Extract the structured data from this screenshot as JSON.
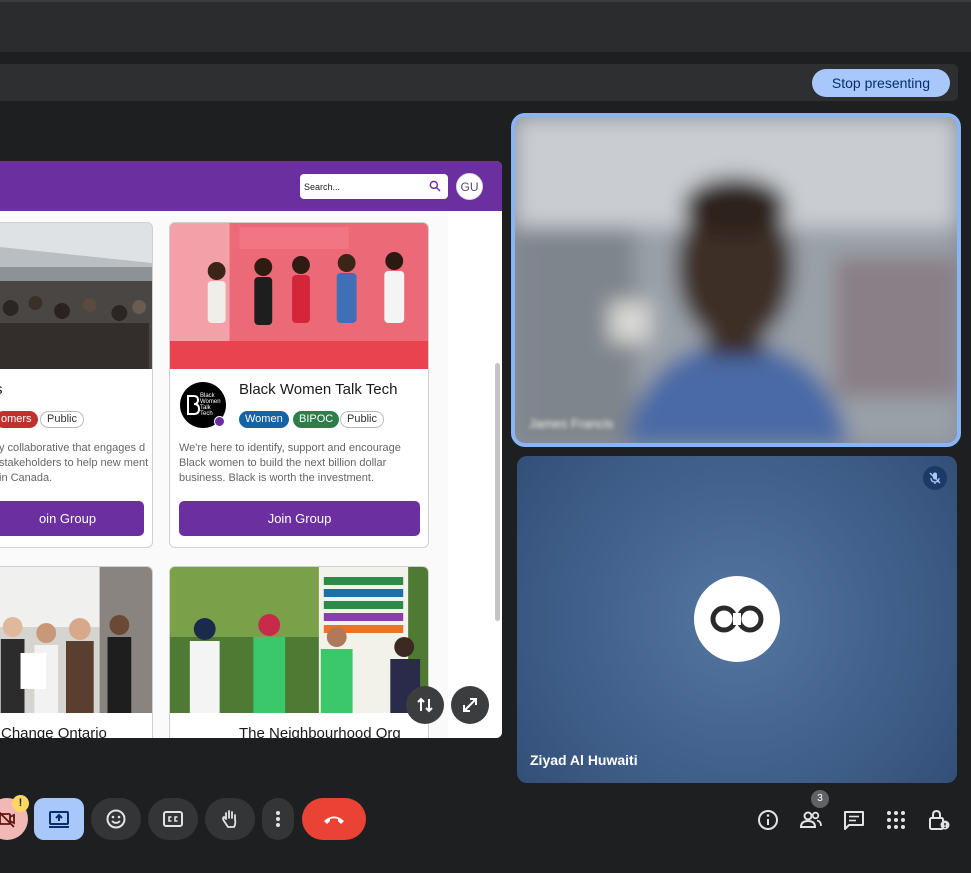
{
  "presentation": {
    "stop_label": "Stop presenting"
  },
  "site": {
    "search_placeholder": "Search...",
    "user_initials": "GU",
    "cards": [
      {
        "title": "s",
        "tags": [
          "omers",
          "Public"
        ],
        "description": "y collaborative that engages d stakeholders to help new ment in Canada.",
        "button": "oin Group"
      },
      {
        "title": "Black Women Talk Tech",
        "logo_text": "Black Women Talk Tech",
        "tags": [
          "Women",
          "BIPOC",
          "Public"
        ],
        "description": "We're here to identify, support and encourage Black women to build the next billion dollar business. Black is worth the investment.",
        "button": "Join Group"
      },
      {
        "title": "Change Ontario"
      },
      {
        "title": "The Neighbourhood Org"
      }
    ]
  },
  "participants": {
    "self_name": "James Francis",
    "remote_name": "Ziyad Al Huwaiti",
    "count": "3"
  },
  "colors": {
    "accent": "#8ab4f8",
    "brand_purple": "#6b2fa0",
    "hangup": "#ea4335",
    "present_active": "#a8c7fa"
  },
  "controls": {
    "icons": [
      "camera-off-icon",
      "present-screen-icon",
      "emoji-icon",
      "captions-icon",
      "raise-hand-icon",
      "more-options-icon",
      "hang-up-icon"
    ],
    "right_icons": [
      "info-icon",
      "people-icon",
      "chat-icon",
      "activities-icon",
      "host-controls-icon"
    ]
  }
}
